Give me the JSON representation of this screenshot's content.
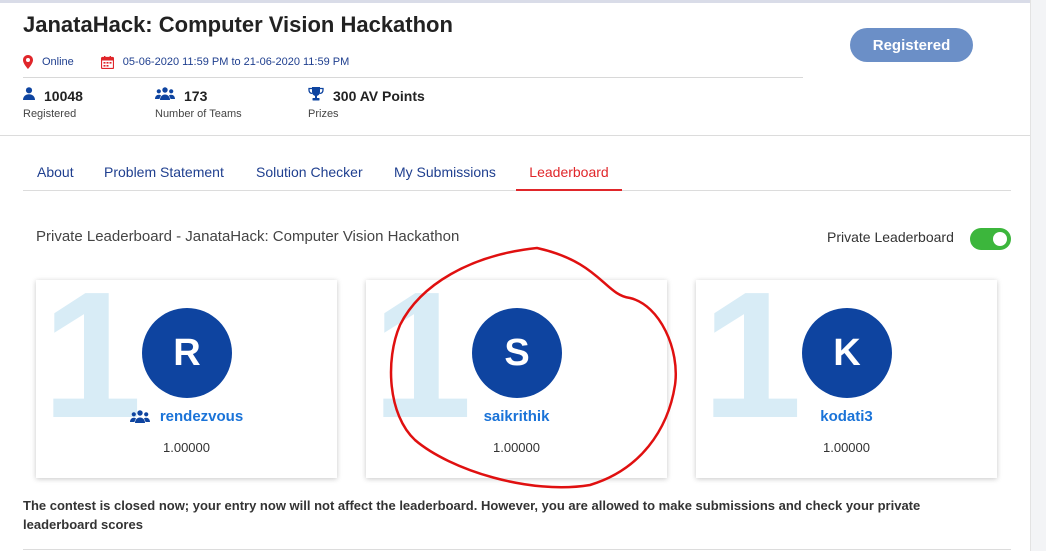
{
  "contest": {
    "title": "JanataHack: Computer Vision Hackathon",
    "location": "Online",
    "dates": "05-06-2020 11:59 PM to 21-06-2020 11:59 PM",
    "register_label": "Registered"
  },
  "stats": [
    {
      "icon": "user-icon",
      "value": "10048",
      "label": "Registered"
    },
    {
      "icon": "team-icon",
      "value": "173",
      "label": "Number of Teams"
    },
    {
      "icon": "trophy-icon",
      "value": "300 AV Points",
      "label": "Prizes"
    }
  ],
  "tabs": [
    {
      "label": "About",
      "active": false
    },
    {
      "label": "Problem Statement",
      "active": false
    },
    {
      "label": "Solution Checker",
      "active": false
    },
    {
      "label": "My Submissions",
      "active": false
    },
    {
      "label": "Leaderboard",
      "active": true
    }
  ],
  "leaderboard": {
    "title": "Private Leaderboard - JanataHack: Computer Vision Hackathon",
    "toggle_label": "Private Leaderboard",
    "toggle_on": true,
    "entries": [
      {
        "rank": "1",
        "initial": "R",
        "name": "rendezvous",
        "score": "1.00000",
        "is_team": true
      },
      {
        "rank": "1",
        "initial": "S",
        "name": "saikrithik",
        "score": "1.00000",
        "is_team": false
      },
      {
        "rank": "1",
        "initial": "K",
        "name": "kodati3",
        "score": "1.00000",
        "is_team": false
      }
    ]
  },
  "notice": "The contest is closed now; your entry now will not affect the leaderboard. However, you are allowed to make submissions and check your private leaderboard scores",
  "colors": {
    "accent_blue": "#1f3f8f",
    "avatar_blue": "#0e44a0",
    "link_blue": "#1a73d8",
    "active_red": "#e0262a",
    "toggle_green": "#3cb63c",
    "button_blue": "#6b8fc7",
    "annotation_red": "#e01010"
  }
}
